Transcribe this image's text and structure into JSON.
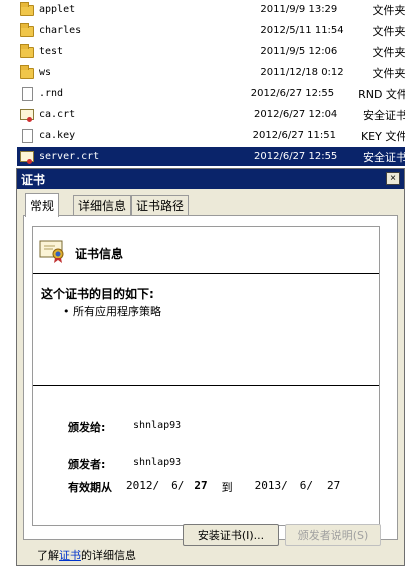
{
  "file_list": [
    {
      "name": "applet",
      "date": "2011/9/9 13:29",
      "type": "文件夹",
      "icon": "folder-icon"
    },
    {
      "name": "charles",
      "date": "2012/5/11 11:54",
      "type": "文件夹",
      "icon": "folder-icon"
    },
    {
      "name": "test",
      "date": "2011/9/5 12:06",
      "type": "文件夹",
      "icon": "folder-icon"
    },
    {
      "name": "ws",
      "date": "2011/12/18 0:12",
      "type": "文件夹",
      "icon": "folder-icon"
    },
    {
      "name": ".rnd",
      "date": "2012/6/27 12:55",
      "type": "RND 文件",
      "icon": "document-icon"
    },
    {
      "name": "ca.crt",
      "date": "2012/6/27 12:04",
      "type": "安全证书",
      "icon": "certificate-icon"
    },
    {
      "name": "ca.key",
      "date": "2012/6/27 11:51",
      "type": "KEY 文件",
      "icon": "document-icon"
    },
    {
      "name": "server.crt",
      "date": "2012/6/27 12:55",
      "type": "安全证书",
      "icon": "certificate-icon"
    }
  ],
  "selected_file_index": 7,
  "dialog": {
    "title": "证书",
    "close_label": "×",
    "tabs": [
      {
        "label": "常规",
        "active": true
      },
      {
        "label": "详细信息",
        "active": false
      },
      {
        "label": "证书路径",
        "active": false
      }
    ],
    "cert_info_title": "证书信息",
    "purpose_heading": "这个证书的目的如下:",
    "purpose_items": [
      "• 所有应用程序策略"
    ],
    "issued_to_label": "颁发给:",
    "issued_to_value": "shnlap93",
    "issued_by_label": "颁发者:",
    "issued_by_value": "shnlap93",
    "validity": {
      "label": "有效期从",
      "from_year": "2012/",
      "from_month": "6/",
      "from_day": "27",
      "to_label": "到",
      "to_year": "2013/",
      "to_month": "6/",
      "to_day": "27"
    },
    "install_button": "安装证书(I)...",
    "issuer_statement_button": "颁发者说明(S)",
    "learn_more_prefix": "了解",
    "learn_more_link": "证书",
    "learn_more_suffix": "的详细信息"
  },
  "colors": {
    "selection": "#0a246a",
    "dialog_face": "#ece9d8",
    "link": "#0033cc"
  }
}
